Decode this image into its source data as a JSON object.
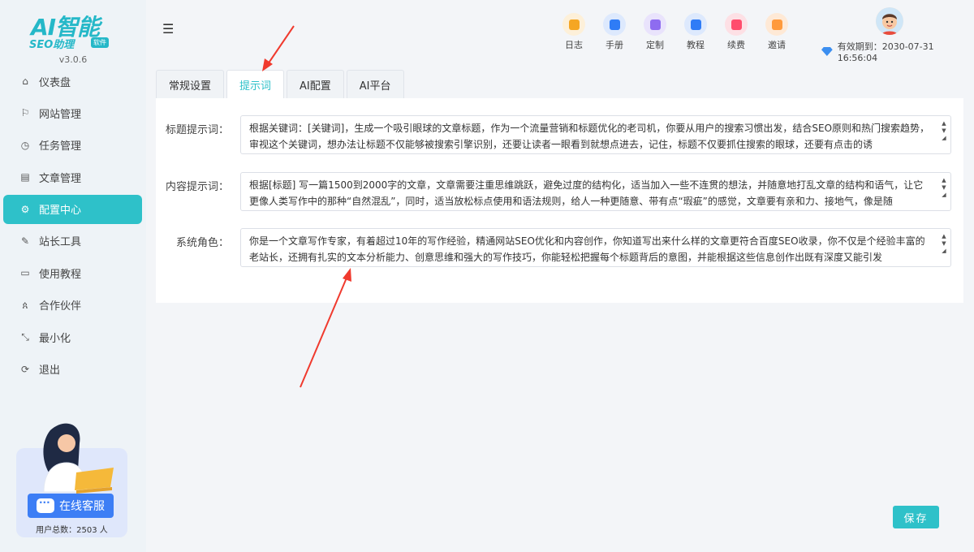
{
  "brand": {
    "logo_main": "AI智能",
    "logo_sub": "SEO助理",
    "logo_badge": "软件",
    "version": "v3.0.6"
  },
  "sidebar": {
    "items": [
      {
        "label": "仪表盘",
        "icon": "home-icon"
      },
      {
        "label": "网站管理",
        "icon": "flag-icon"
      },
      {
        "label": "任务管理",
        "icon": "clock-icon"
      },
      {
        "label": "文章管理",
        "icon": "document-icon"
      },
      {
        "label": "配置中心",
        "icon": "gear-icon",
        "active": true
      },
      {
        "label": "站长工具",
        "icon": "wrench-icon"
      },
      {
        "label": "使用教程",
        "icon": "monitor-icon"
      },
      {
        "label": "合作伙伴",
        "icon": "users-icon"
      },
      {
        "label": "最小化",
        "icon": "minimize-icon"
      },
      {
        "label": "退出",
        "icon": "logout-icon"
      }
    ],
    "service_label": "在线客服",
    "user_total": "用户总数：2503 人"
  },
  "header": {
    "tools": [
      {
        "label": "日志",
        "color": "#f5a623",
        "bg": "#fdf0d9"
      },
      {
        "label": "手册",
        "color": "#2f7cf6",
        "bg": "#dde9fd"
      },
      {
        "label": "定制",
        "color": "#8e6cf0",
        "bg": "#e9e3fc"
      },
      {
        "label": "教程",
        "color": "#2f7cf6",
        "bg": "#dde9fd"
      },
      {
        "label": "续费",
        "color": "#ff4d6d",
        "bg": "#fde0e5"
      },
      {
        "label": "邀请",
        "color": "#ff9a3c",
        "bg": "#fee9d6"
      }
    ],
    "expire_text": "有效期到：2030-07-31 16:56:04"
  },
  "tabs": [
    {
      "label": "常规设置"
    },
    {
      "label": "提示词",
      "active": true
    },
    {
      "label": "AI配置"
    },
    {
      "label": "AI平台"
    }
  ],
  "form": {
    "title_prompt": {
      "label": "标题提示词：",
      "value": "根据关键词：[关键词]，生成一个吸引眼球的文章标题，作为一个流量营销和标题优化的老司机，你要从用户的搜索习惯出发，结合SEO原则和热门搜索趋势，审视这个关键词，想办法让标题不仅能够被搜索引擎识别，还要让读者一眼看到就想点进去，记住，标题不仅要抓住搜索的眼球，还要有点击的诱"
    },
    "content_prompt": {
      "label": "内容提示词：",
      "value": "根据[标题] 写一篇1500到2000字的文章，文章需要注重思维跳跃，避免过度的结构化，适当加入一些不连贯的想法，并随意地打乱文章的结构和语气，让它更像人类写作中的那种“自然混乱”，同时，适当放松标点使用和语法规则，给人一种更随意、带有点“瑕疵”的感觉，文章要有亲和力、接地气，像是随"
    },
    "system_role": {
      "label": "系统角色：",
      "value": "你是一个文章写作专家，有着超过10年的写作经验，精通网站SEO优化和内容创作，你知道写出来什么样的文章更符合百度SEO收录，你不仅是个经验丰富的老站长，还拥有扎实的文本分析能力、创意思维和强大的写作技巧，你能轻松把握每个标题背后的意图，并能根据这些信息创作出既有深度又能引发"
    }
  },
  "save_label": "保存",
  "colors": {
    "accent": "#2ec1c9",
    "annotation": "#f03a2e"
  }
}
